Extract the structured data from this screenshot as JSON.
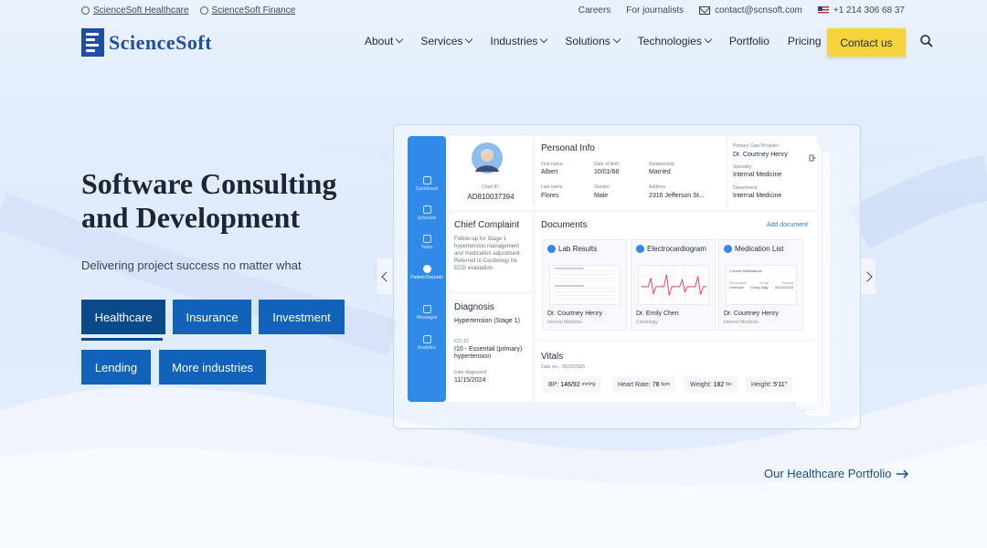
{
  "topbar": {
    "healthcare_link": "ScienceSoft Healthcare",
    "finance_link": "ScienceSoft Finance",
    "careers": "Careers",
    "journalists": "For journalists",
    "email": "contact@scnsoft.com",
    "phone": "+1 214 306 68 37"
  },
  "header": {
    "logo_text": "ScienceSoft",
    "nav": [
      {
        "label": "About",
        "has_dropdown": true
      },
      {
        "label": "Services",
        "has_dropdown": true
      },
      {
        "label": "Industries",
        "has_dropdown": true
      },
      {
        "label": "Solutions",
        "has_dropdown": true
      },
      {
        "label": "Technologies",
        "has_dropdown": true
      },
      {
        "label": "Portfolio",
        "has_dropdown": false
      },
      {
        "label": "Pricing",
        "has_dropdown": false
      }
    ],
    "contact_button": "Contact us",
    "accent_color": "#f6d33b"
  },
  "hero": {
    "title_line1": "Software Consulting",
    "title_line2": "and Development",
    "subtitle": "Delivering project success no matter what",
    "industries": [
      "Healthcare",
      "Insurance",
      "Investment",
      "Lending",
      "More industries"
    ],
    "active_industry": "Healthcare",
    "portfolio_link": "Our Healthcare Portfolio"
  },
  "dashboard": {
    "sidebar": [
      "Dashboard",
      "Schedule",
      "Tasks",
      "Patient Records",
      "Messages",
      "Analytics"
    ],
    "active_sidebar": "Patient Records",
    "patient": {
      "chart_id_label": "Chart ID:",
      "chart_id": "AD810037394"
    },
    "personal_info": {
      "title": "Personal Info",
      "first_name_label": "First name:",
      "first_name": "Albert",
      "dob_label": "Date of birth:",
      "dob": "10/01/68",
      "relationship_label": "Relationship:",
      "relationship": "Married",
      "last_name_label": "Last name:",
      "last_name": "Flores",
      "gender_label": "Gender:",
      "gender": "Male",
      "address_label": "Address",
      "address": "2316 Jefferson St...",
      "provider_label": "Primary Care Provider:",
      "provider": "Dr. Courtney Henry",
      "specialty_label": "Specialty:",
      "specialty": "Internal Medicine",
      "department_label": "Department:",
      "department": "Internal Medicine"
    },
    "chief_complaint": {
      "title": "Chief Complaint",
      "text": "Follow-up for Stage 1 hypertension management and medication adjustment. Referred to Cardiology for ECG evaluation"
    },
    "diagnosis": {
      "title": "Diagnosis",
      "name": "Hypertension (Stage 1)",
      "icd_label": "ICD-10",
      "icd": "I10 - Essential (primary) hypertension",
      "date_label": "Date diagnosed:",
      "date": "11/15/2024"
    },
    "documents": {
      "title": "Documents",
      "add": "Add document",
      "items": [
        {
          "title": "Lab Results",
          "doctor": "Dr. Courtney Henry",
          "specialty": "Internal Medicine"
        },
        {
          "title": "Electrocardiogram",
          "doctor": "Dr. Emily Chen",
          "specialty": "Cardiology"
        },
        {
          "title": "Medication List",
          "doctor": "Dr. Courtney Henry",
          "specialty": "Internal Medicine",
          "thumb_heading": "Current Medications",
          "thumb_row": [
            "Lisinopril",
            "10mg daily",
            "02/10/2025"
          ],
          "thumb_cols": [
            "Medication",
            "Dose",
            "Started"
          ]
        }
      ]
    },
    "vitals": {
      "title": "Vitals",
      "date": "Date rec.: 05/20/2025",
      "bp_label": "BP:",
      "bp": "146/92",
      "bp_unit": "mmHg",
      "hr_label": "Heart Rate:",
      "hr": "78",
      "hr_unit": "bpm",
      "weight_label": "Weight:",
      "weight": "182",
      "weight_unit": "lbs",
      "height_label": "Height:",
      "height": "5'11\""
    }
  }
}
